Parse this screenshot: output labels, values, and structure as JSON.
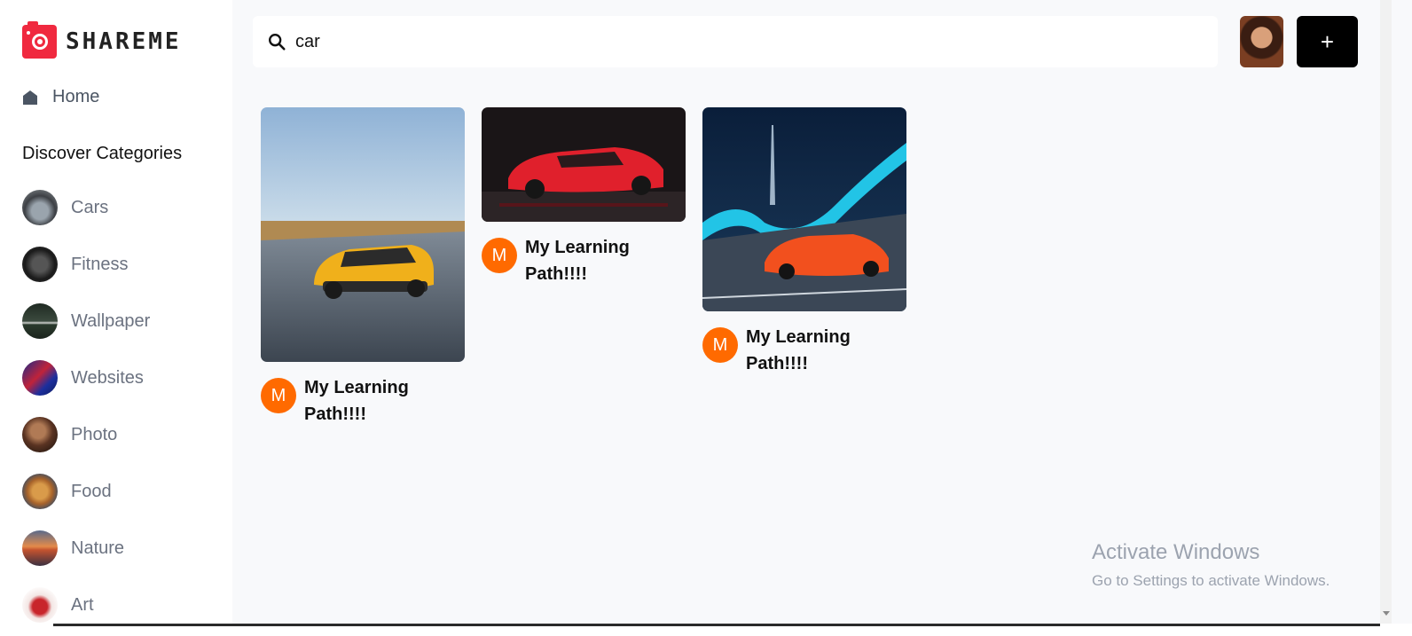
{
  "brand": {
    "name": "SHAREME",
    "accent": "#f0293f"
  },
  "sidebar": {
    "home_label": "Home",
    "discover_heading": "Discover Categories",
    "categories": [
      {
        "label": "Cars"
      },
      {
        "label": "Fitness"
      },
      {
        "label": "Wallpaper"
      },
      {
        "label": "Websites"
      },
      {
        "label": "Photo"
      },
      {
        "label": "Food"
      },
      {
        "label": "Nature"
      },
      {
        "label": "Art"
      }
    ]
  },
  "header": {
    "search_value": "car",
    "add_label": "+"
  },
  "pins": [
    {
      "author_initial": "M",
      "title": "My Learning Path!!!!"
    },
    {
      "author_initial": "M",
      "title": "My Learning Path!!!!"
    },
    {
      "author_initial": "M",
      "title": "My Learning Path!!!!"
    }
  ],
  "watermark": {
    "title": "Activate Windows",
    "subtitle": "Go to Settings to activate Windows."
  },
  "colors": {
    "avatar_orange": "#ff6a00",
    "sidebar_bg": "#ffffff",
    "page_bg": "#f8f9fb"
  }
}
